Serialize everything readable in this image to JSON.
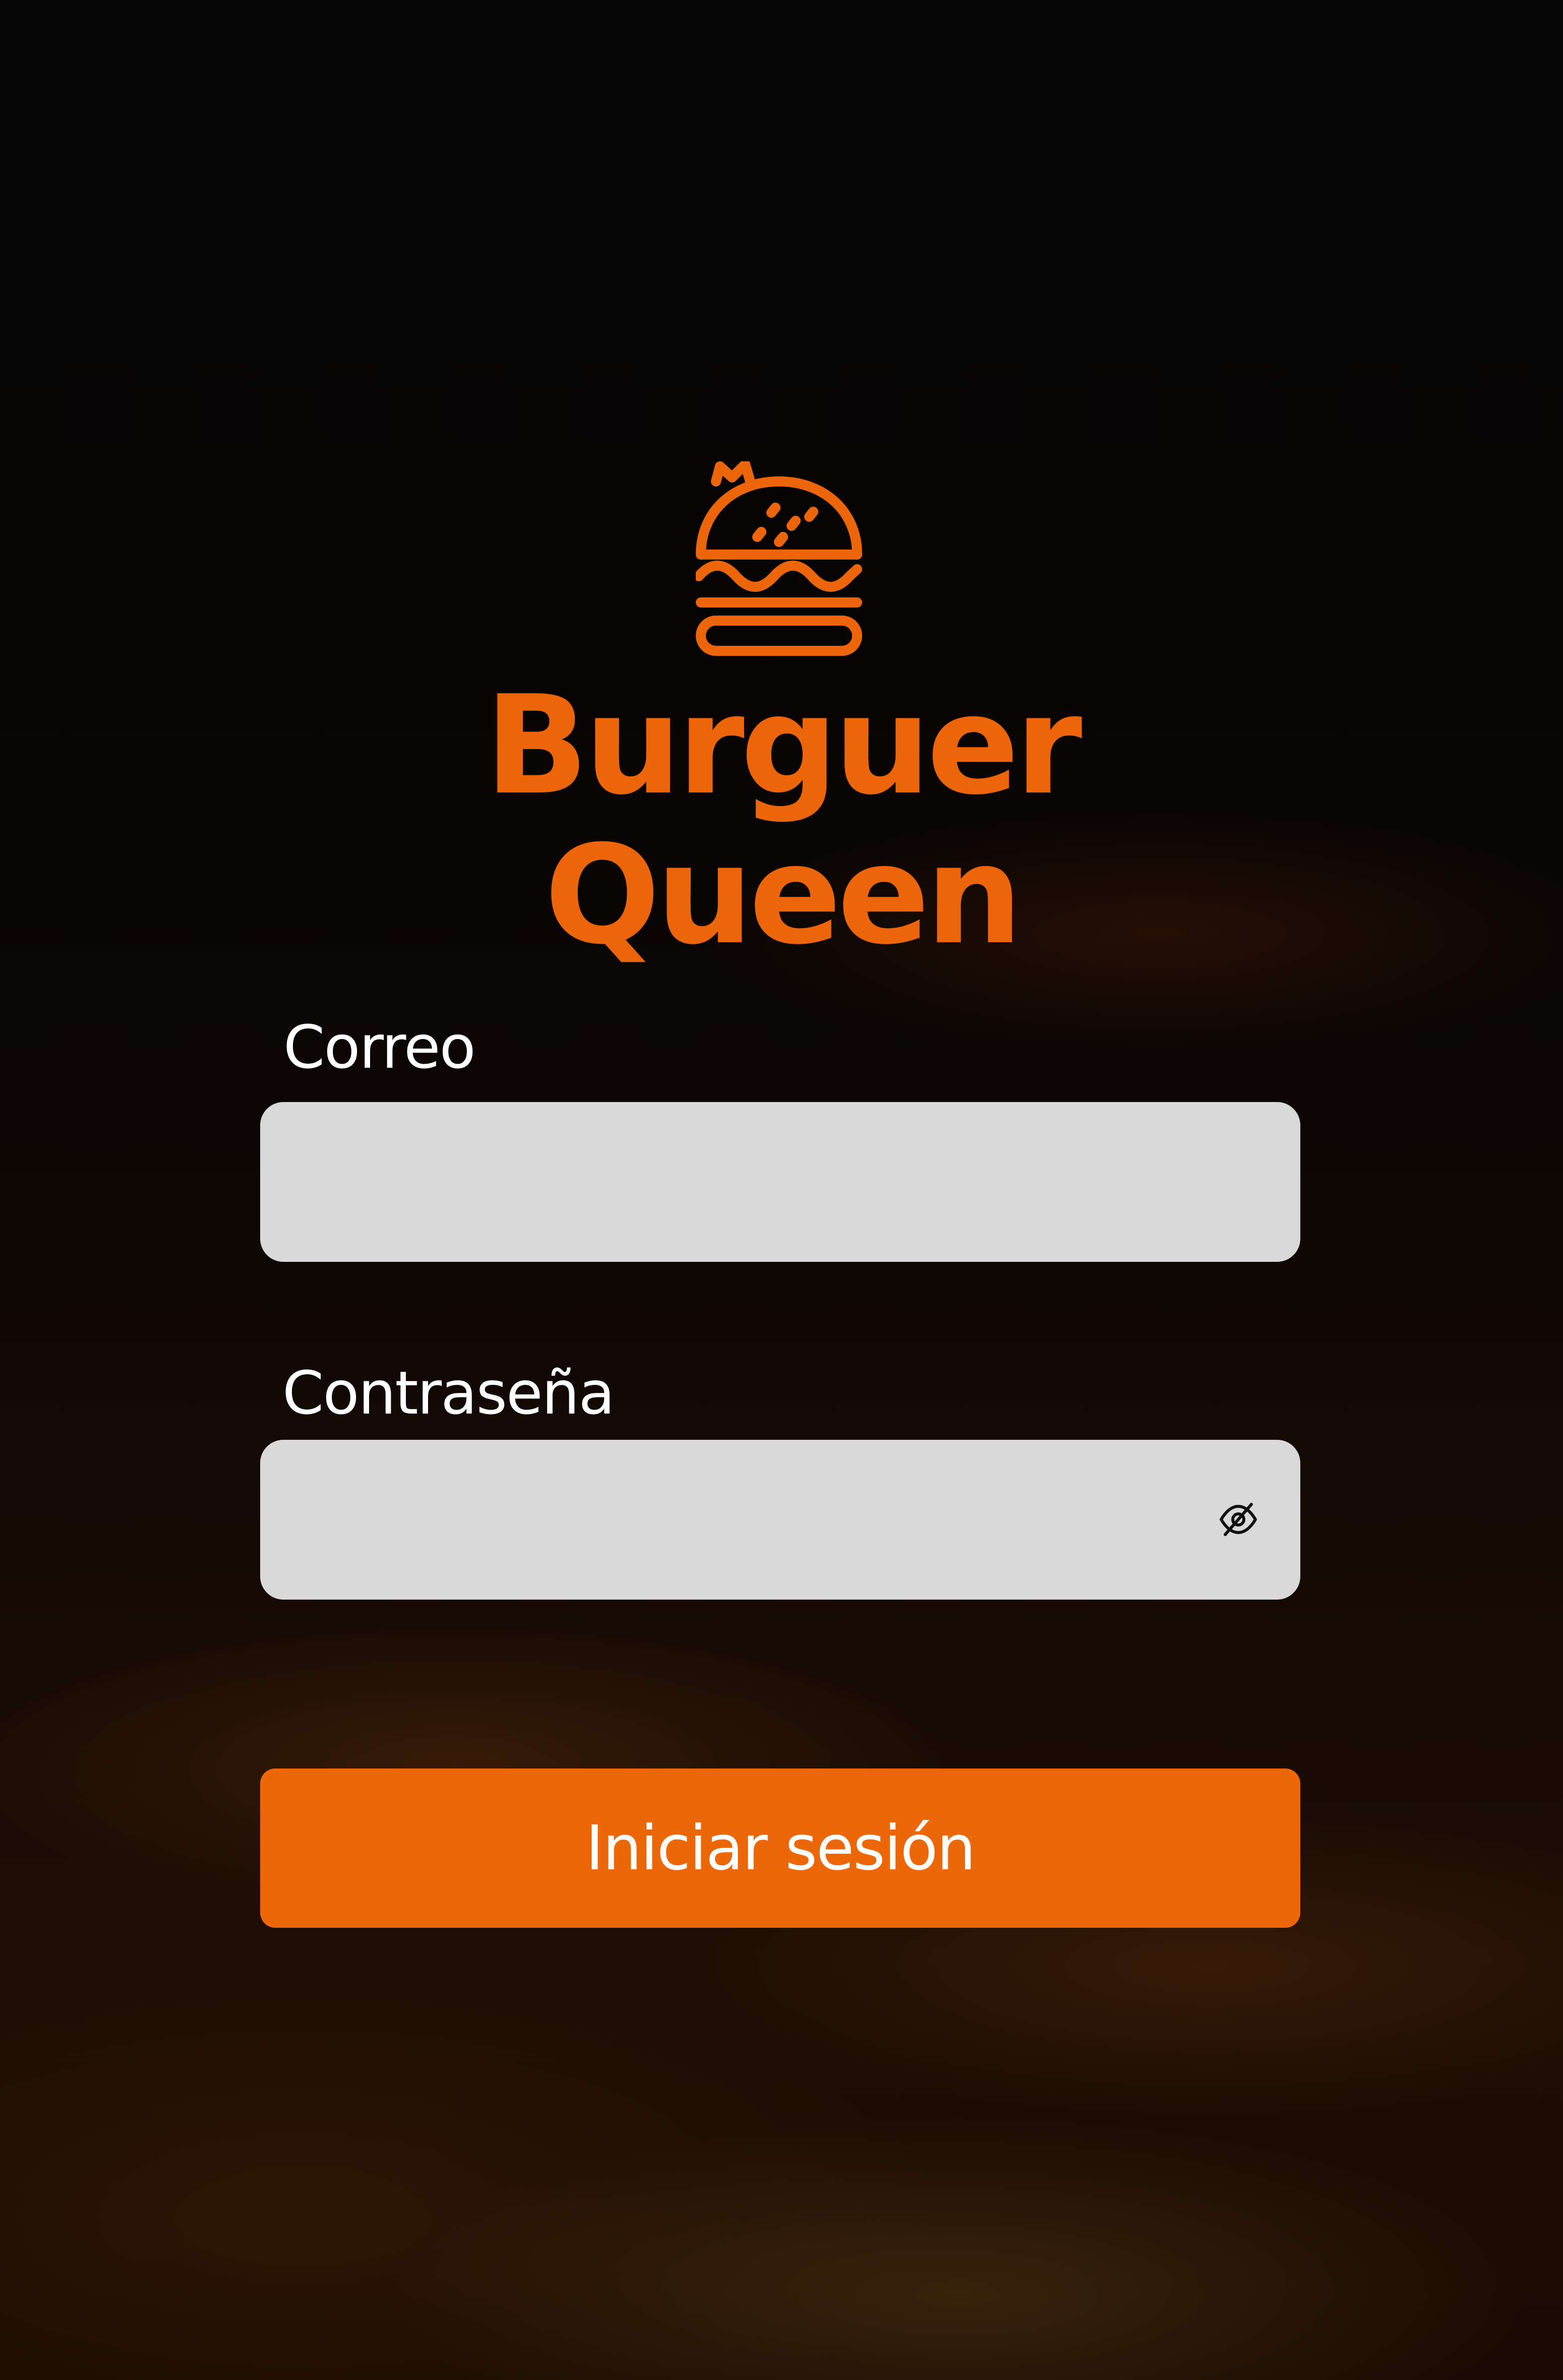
{
  "brand": {
    "name": "Burguer Queen",
    "logo_icon": "crowned-burger-icon",
    "accent_color": "#ec6609"
  },
  "form": {
    "email": {
      "label": "Correo",
      "value": "",
      "placeholder": ""
    },
    "password": {
      "label": "Contraseña",
      "value": "",
      "placeholder": "",
      "toggle_icon": "eye-off-icon"
    },
    "submit_label": "Iniciar sesión"
  },
  "colors": {
    "background": "#040404",
    "field_background": "#d9d9d9",
    "button_background": "#eb6708",
    "label_text": "#ffffff"
  }
}
